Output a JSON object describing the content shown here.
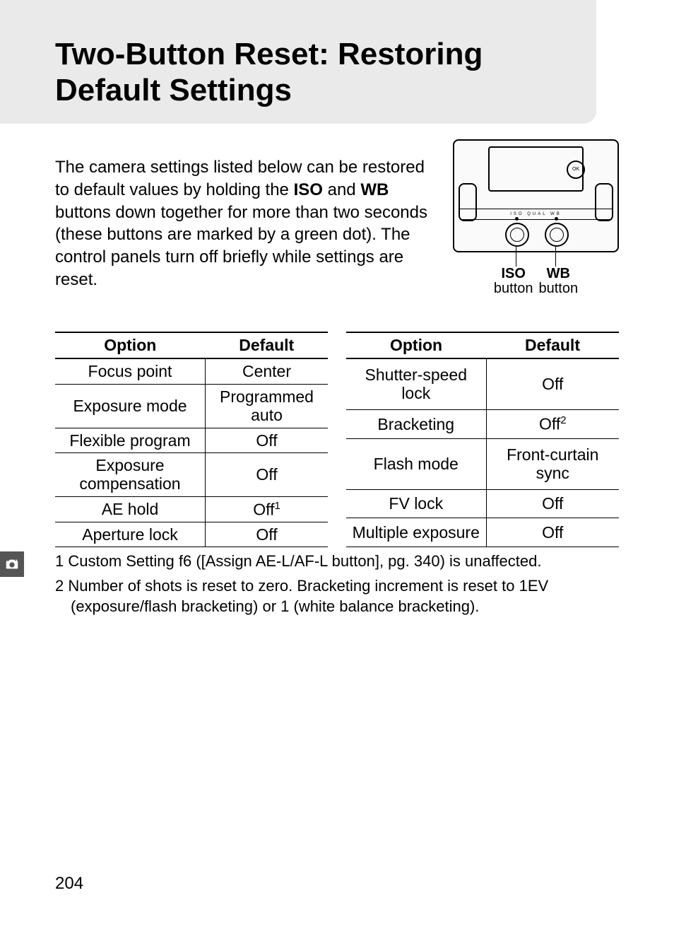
{
  "title": "Two-Button Reset: Restoring Default Settings",
  "intro": {
    "part1": "The camera settings listed below can be restored to default values by holding the ",
    "b1": "ISO",
    "part2": " and ",
    "b2": "WB",
    "part3": " buttons down together for more than two seconds (these buttons are marked by a green dot).  The control panels turn off briefly while settings are reset."
  },
  "diagram": {
    "iso_bold": "ISO",
    "iso_word": "button",
    "wb_bold": "WB",
    "wb_word": "button"
  },
  "headers": {
    "option": "Option",
    "default": "Default"
  },
  "left_rows": [
    {
      "o": "Focus point",
      "d": "Center",
      "sup": ""
    },
    {
      "o": "Exposure mode",
      "d": "Programmed auto",
      "sup": ""
    },
    {
      "o": "Flexible program",
      "d": "Off",
      "sup": ""
    },
    {
      "o": "Exposure compensation",
      "d": "Off",
      "sup": ""
    },
    {
      "o": "AE hold",
      "d": "Off",
      "sup": "1"
    },
    {
      "o": "Aperture lock",
      "d": "Off",
      "sup": ""
    }
  ],
  "right_rows": [
    {
      "o": "Shutter-speed lock",
      "d": "Off",
      "sup": ""
    },
    {
      "o": "Bracketing",
      "d": "Off",
      "sup": "2"
    },
    {
      "o": "Flash mode",
      "d": "Front-curtain sync",
      "sup": ""
    },
    {
      "o": "FV lock",
      "d": "Off",
      "sup": ""
    },
    {
      "o": "Multiple exposure",
      "d": "Off",
      "sup": ""
    }
  ],
  "footnotes": {
    "f1": "1  Custom Setting f6 ([Assign AE-L/AF-L button], pg. 340) is unaffected.",
    "f2": "2  Number of shots is reset to zero.  Bracketing increment is reset to 1EV (exposure/flash bracketing) or 1 (white balance bracketing)."
  },
  "page_number": "204"
}
